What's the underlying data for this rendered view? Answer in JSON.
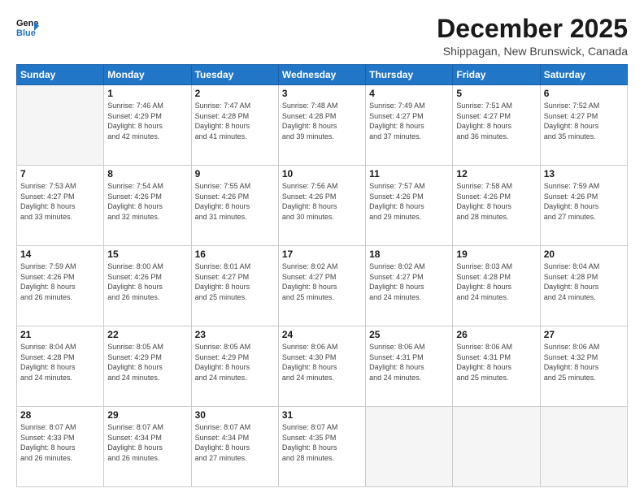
{
  "header": {
    "logo_line1": "General",
    "logo_line2": "Blue",
    "title": "December 2025",
    "subtitle": "Shippagan, New Brunswick, Canada"
  },
  "weekdays": [
    "Sunday",
    "Monday",
    "Tuesday",
    "Wednesday",
    "Thursday",
    "Friday",
    "Saturday"
  ],
  "weeks": [
    [
      {
        "day": "",
        "info": ""
      },
      {
        "day": "1",
        "info": "Sunrise: 7:46 AM\nSunset: 4:29 PM\nDaylight: 8 hours\nand 42 minutes."
      },
      {
        "day": "2",
        "info": "Sunrise: 7:47 AM\nSunset: 4:28 PM\nDaylight: 8 hours\nand 41 minutes."
      },
      {
        "day": "3",
        "info": "Sunrise: 7:48 AM\nSunset: 4:28 PM\nDaylight: 8 hours\nand 39 minutes."
      },
      {
        "day": "4",
        "info": "Sunrise: 7:49 AM\nSunset: 4:27 PM\nDaylight: 8 hours\nand 37 minutes."
      },
      {
        "day": "5",
        "info": "Sunrise: 7:51 AM\nSunset: 4:27 PM\nDaylight: 8 hours\nand 36 minutes."
      },
      {
        "day": "6",
        "info": "Sunrise: 7:52 AM\nSunset: 4:27 PM\nDaylight: 8 hours\nand 35 minutes."
      }
    ],
    [
      {
        "day": "7",
        "info": "Sunrise: 7:53 AM\nSunset: 4:27 PM\nDaylight: 8 hours\nand 33 minutes."
      },
      {
        "day": "8",
        "info": "Sunrise: 7:54 AM\nSunset: 4:26 PM\nDaylight: 8 hours\nand 32 minutes."
      },
      {
        "day": "9",
        "info": "Sunrise: 7:55 AM\nSunset: 4:26 PM\nDaylight: 8 hours\nand 31 minutes."
      },
      {
        "day": "10",
        "info": "Sunrise: 7:56 AM\nSunset: 4:26 PM\nDaylight: 8 hours\nand 30 minutes."
      },
      {
        "day": "11",
        "info": "Sunrise: 7:57 AM\nSunset: 4:26 PM\nDaylight: 8 hours\nand 29 minutes."
      },
      {
        "day": "12",
        "info": "Sunrise: 7:58 AM\nSunset: 4:26 PM\nDaylight: 8 hours\nand 28 minutes."
      },
      {
        "day": "13",
        "info": "Sunrise: 7:59 AM\nSunset: 4:26 PM\nDaylight: 8 hours\nand 27 minutes."
      }
    ],
    [
      {
        "day": "14",
        "info": "Sunrise: 7:59 AM\nSunset: 4:26 PM\nDaylight: 8 hours\nand 26 minutes."
      },
      {
        "day": "15",
        "info": "Sunrise: 8:00 AM\nSunset: 4:26 PM\nDaylight: 8 hours\nand 26 minutes."
      },
      {
        "day": "16",
        "info": "Sunrise: 8:01 AM\nSunset: 4:27 PM\nDaylight: 8 hours\nand 25 minutes."
      },
      {
        "day": "17",
        "info": "Sunrise: 8:02 AM\nSunset: 4:27 PM\nDaylight: 8 hours\nand 25 minutes."
      },
      {
        "day": "18",
        "info": "Sunrise: 8:02 AM\nSunset: 4:27 PM\nDaylight: 8 hours\nand 24 minutes."
      },
      {
        "day": "19",
        "info": "Sunrise: 8:03 AM\nSunset: 4:28 PM\nDaylight: 8 hours\nand 24 minutes."
      },
      {
        "day": "20",
        "info": "Sunrise: 8:04 AM\nSunset: 4:28 PM\nDaylight: 8 hours\nand 24 minutes."
      }
    ],
    [
      {
        "day": "21",
        "info": "Sunrise: 8:04 AM\nSunset: 4:28 PM\nDaylight: 8 hours\nand 24 minutes."
      },
      {
        "day": "22",
        "info": "Sunrise: 8:05 AM\nSunset: 4:29 PM\nDaylight: 8 hours\nand 24 minutes."
      },
      {
        "day": "23",
        "info": "Sunrise: 8:05 AM\nSunset: 4:29 PM\nDaylight: 8 hours\nand 24 minutes."
      },
      {
        "day": "24",
        "info": "Sunrise: 8:06 AM\nSunset: 4:30 PM\nDaylight: 8 hours\nand 24 minutes."
      },
      {
        "day": "25",
        "info": "Sunrise: 8:06 AM\nSunset: 4:31 PM\nDaylight: 8 hours\nand 24 minutes."
      },
      {
        "day": "26",
        "info": "Sunrise: 8:06 AM\nSunset: 4:31 PM\nDaylight: 8 hours\nand 25 minutes."
      },
      {
        "day": "27",
        "info": "Sunrise: 8:06 AM\nSunset: 4:32 PM\nDaylight: 8 hours\nand 25 minutes."
      }
    ],
    [
      {
        "day": "28",
        "info": "Sunrise: 8:07 AM\nSunset: 4:33 PM\nDaylight: 8 hours\nand 26 minutes."
      },
      {
        "day": "29",
        "info": "Sunrise: 8:07 AM\nSunset: 4:34 PM\nDaylight: 8 hours\nand 26 minutes."
      },
      {
        "day": "30",
        "info": "Sunrise: 8:07 AM\nSunset: 4:34 PM\nDaylight: 8 hours\nand 27 minutes."
      },
      {
        "day": "31",
        "info": "Sunrise: 8:07 AM\nSunset: 4:35 PM\nDaylight: 8 hours\nand 28 minutes."
      },
      {
        "day": "",
        "info": ""
      },
      {
        "day": "",
        "info": ""
      },
      {
        "day": "",
        "info": ""
      }
    ]
  ]
}
